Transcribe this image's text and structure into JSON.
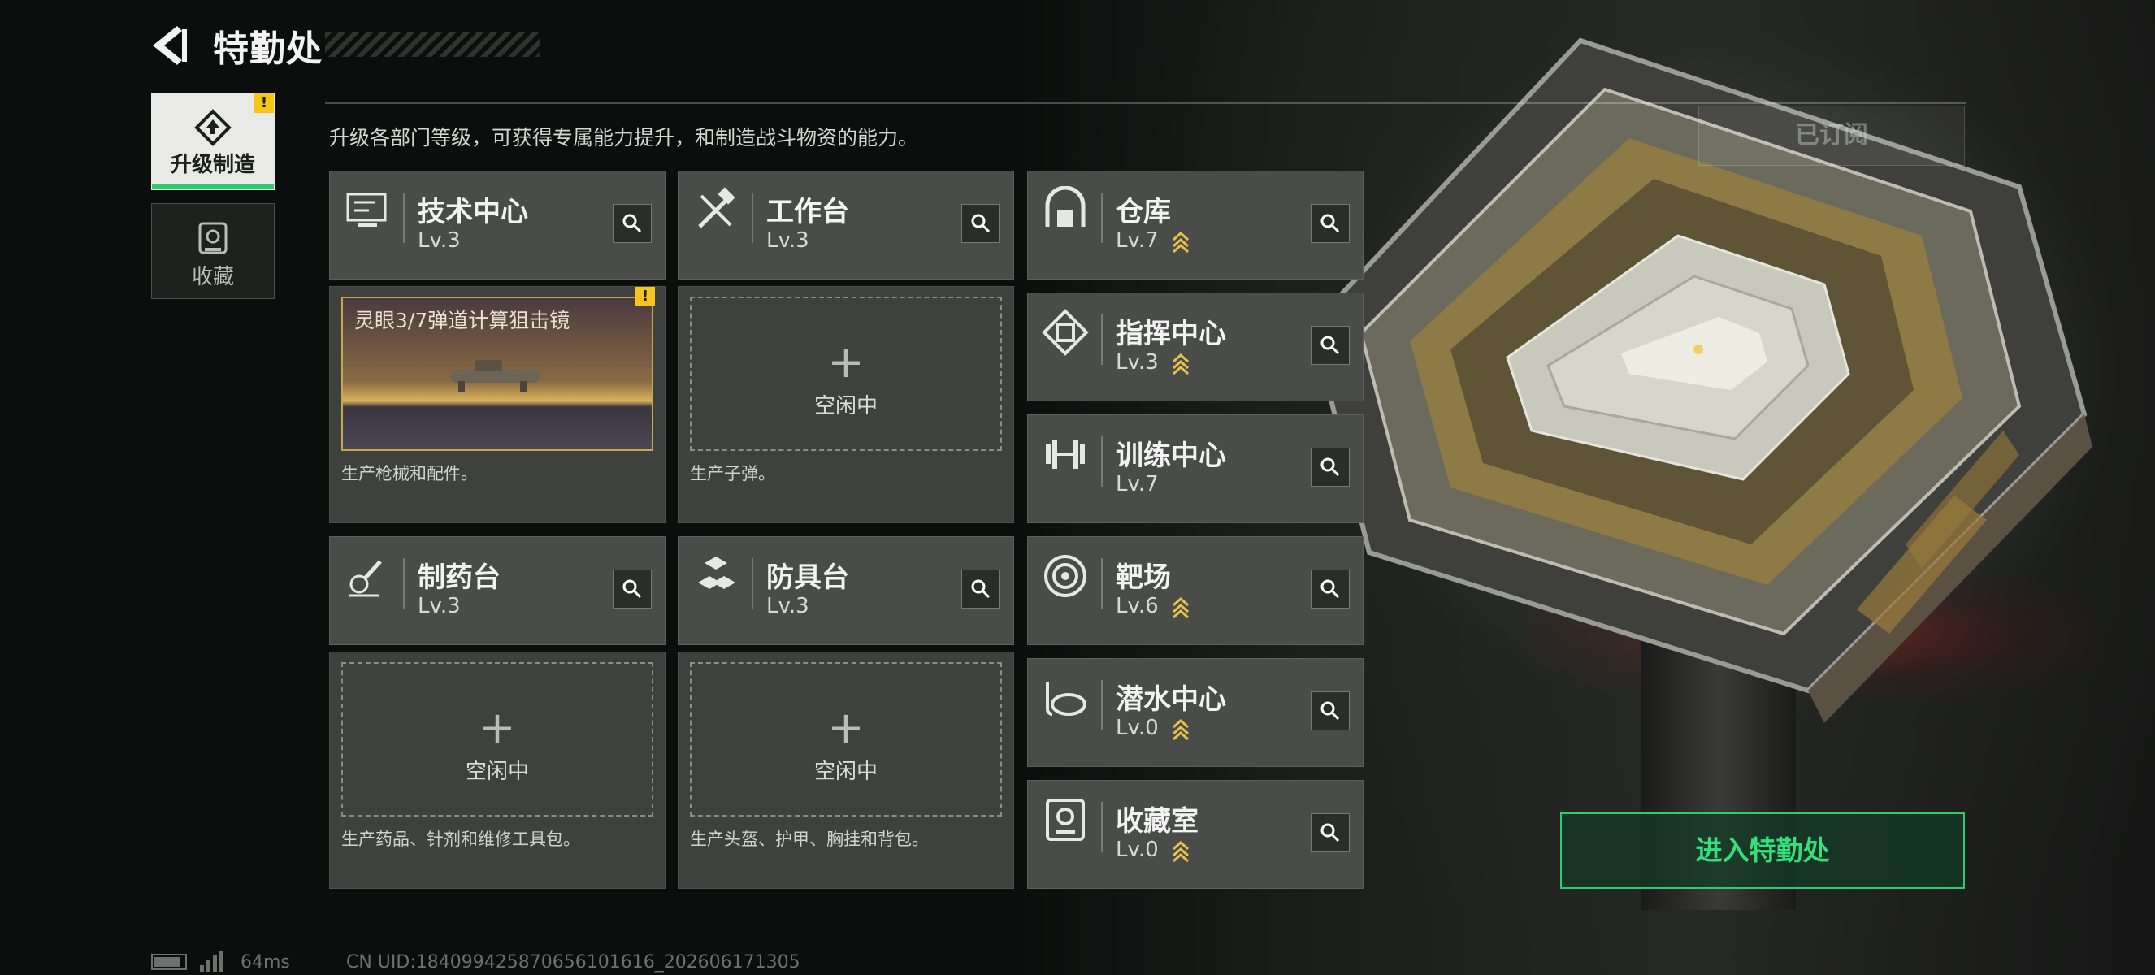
{
  "header": {
    "title": "特勤处"
  },
  "sidebar": {
    "tabs": [
      {
        "label": "升级制造",
        "icon": "upgrade-icon",
        "active": true,
        "alert": "!"
      },
      {
        "label": "收藏",
        "icon": "collection-icon",
        "active": false
      }
    ]
  },
  "main": {
    "description": "升级各部门等级，可获得专属能力提升，和制造战斗物资的能力。",
    "subscribed_label": "已订阅",
    "enter_label": "进入特勤处"
  },
  "departments": [
    {
      "name": "技术中心",
      "level": "Lv.3",
      "icon": "tech-center-icon",
      "upgradable": false
    },
    {
      "name": "工作台",
      "level": "Lv.3",
      "icon": "workbench-icon",
      "upgradable": false
    },
    {
      "name": "制药台",
      "level": "Lv.3",
      "icon": "pharmacy-icon",
      "upgradable": false
    },
    {
      "name": "防具台",
      "level": "Lv.3",
      "icon": "armor-bench-icon",
      "upgradable": false
    },
    {
      "name": "仓库",
      "level": "Lv.7",
      "icon": "warehouse-icon",
      "upgradable": true
    },
    {
      "name": "指挥中心",
      "level": "Lv.3",
      "icon": "command-center-icon",
      "upgradable": true
    },
    {
      "name": "训练中心",
      "level": "Lv.7",
      "icon": "training-center-icon",
      "upgradable": false
    },
    {
      "name": "靶场",
      "level": "Lv.6",
      "icon": "shooting-range-icon",
      "upgradable": true
    },
    {
      "name": "潜水中心",
      "level": "Lv.0",
      "icon": "diving-center-icon",
      "upgradable": true
    },
    {
      "name": "收藏室",
      "level": "Lv.0",
      "icon": "collection-room-icon",
      "upgradable": true
    }
  ],
  "production": [
    {
      "status": "producing",
      "item": "灵眼3/7弹道计算狙击镜",
      "caption": "生产枪械和配件。",
      "alert": "!"
    },
    {
      "status": "idle",
      "idle_label": "空闲中",
      "caption": "生产子弹。"
    },
    {
      "status": "idle",
      "idle_label": "空闲中",
      "caption": "生产药品、针剂和维修工具包。"
    },
    {
      "status": "idle",
      "idle_label": "空闲中",
      "caption": "生产头盔、护甲、胸挂和背包。"
    }
  ],
  "statusbar": {
    "ping": "64ms",
    "uid": "CN UID:18409942587065610161​6_202606171305"
  },
  "colors": {
    "accent": "#2ecc71",
    "alert": "#f5c518",
    "upgrade_chevron": "#e8c04a"
  }
}
